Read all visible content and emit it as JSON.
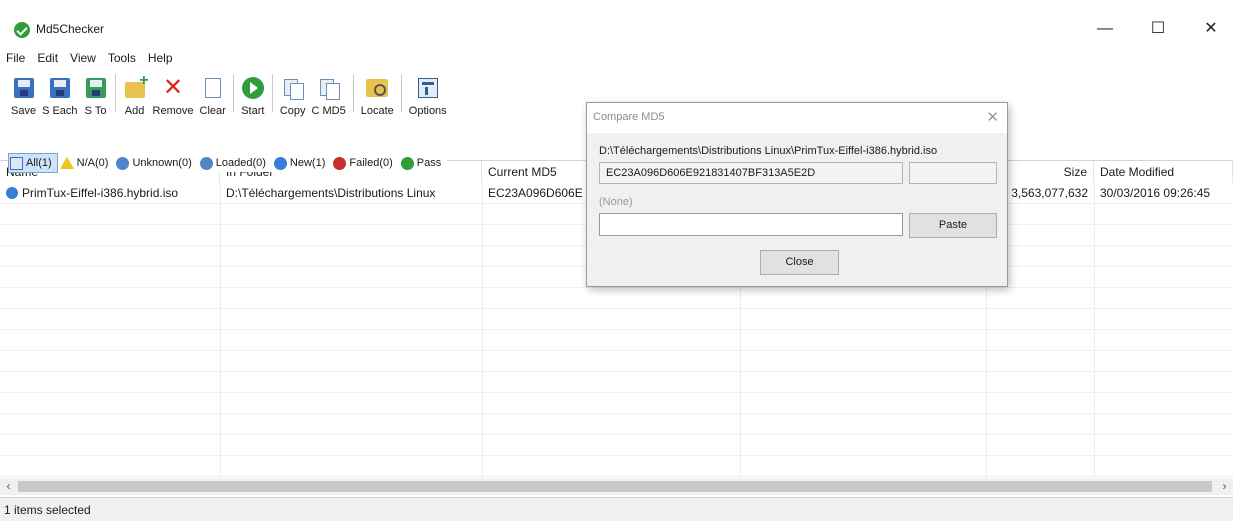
{
  "window": {
    "title": "Md5Checker",
    "minimize": "—",
    "maximize": "☐",
    "close": "✕"
  },
  "menu": [
    "File",
    "Edit",
    "View",
    "Tools",
    "Help"
  ],
  "toolbar": [
    {
      "label": "Save",
      "icon": "save-icon"
    },
    {
      "label": "S Each",
      "icon": "save-each-icon"
    },
    {
      "label": "S To",
      "icon": "save-to-icon"
    },
    {
      "label": "Add",
      "icon": "add-folder-icon"
    },
    {
      "label": "Remove",
      "icon": "remove-icon"
    },
    {
      "label": "Clear",
      "icon": "clear-icon"
    },
    {
      "label": "Start",
      "icon": "start-icon"
    },
    {
      "label": "Copy",
      "icon": "copy-icon"
    },
    {
      "label": "C MD5",
      "icon": "compare-md5-icon"
    },
    {
      "label": "Locate",
      "icon": "locate-icon"
    },
    {
      "label": "Options",
      "icon": "options-icon"
    }
  ],
  "filters": [
    {
      "label": "All(1)",
      "icon": "all-icon",
      "active": true
    },
    {
      "label": "N/A(0)",
      "icon": "warning-icon"
    },
    {
      "label": "Unknown(0)",
      "icon": "unknown-icon"
    },
    {
      "label": "Loaded(0)",
      "icon": "loaded-icon"
    },
    {
      "label": "New(1)",
      "icon": "new-icon"
    },
    {
      "label": "Failed(0)",
      "icon": "failed-icon"
    },
    {
      "label": "Pass",
      "icon": "pass-icon"
    }
  ],
  "columns": {
    "name": "Name",
    "folder": "In Folder",
    "md5": "Current MD5",
    "size": "Size",
    "date": "Date Modified"
  },
  "rows": [
    {
      "name": "PrimTux-Eiffel-i386.hybrid.iso",
      "folder": "D:\\Téléchargements\\Distributions Linux",
      "md5": "EC23A096D606E",
      "size": "3,563,077,632",
      "date": "30/03/2016 09:26:45"
    }
  ],
  "scroll": {
    "left": "‹",
    "right": "›"
  },
  "status": {
    "text": "1 items selected"
  },
  "dialog": {
    "title": "Compare MD5",
    "close_glyph": "✕",
    "path": "D:\\Téléchargements\\Distributions Linux\\PrimTux-Eiffel-i386.hybrid.iso",
    "md5_value": "EC23A096D606E921831407BF313A5E2D",
    "none_label": "(None)",
    "paste_value": "",
    "paste_button": "Paste",
    "close_button": "Close"
  },
  "colors": {
    "accent_green": "#2e9d3a",
    "filter_active_bg": "#cde3f8",
    "scroll_thumb": "#c8c8c8"
  }
}
